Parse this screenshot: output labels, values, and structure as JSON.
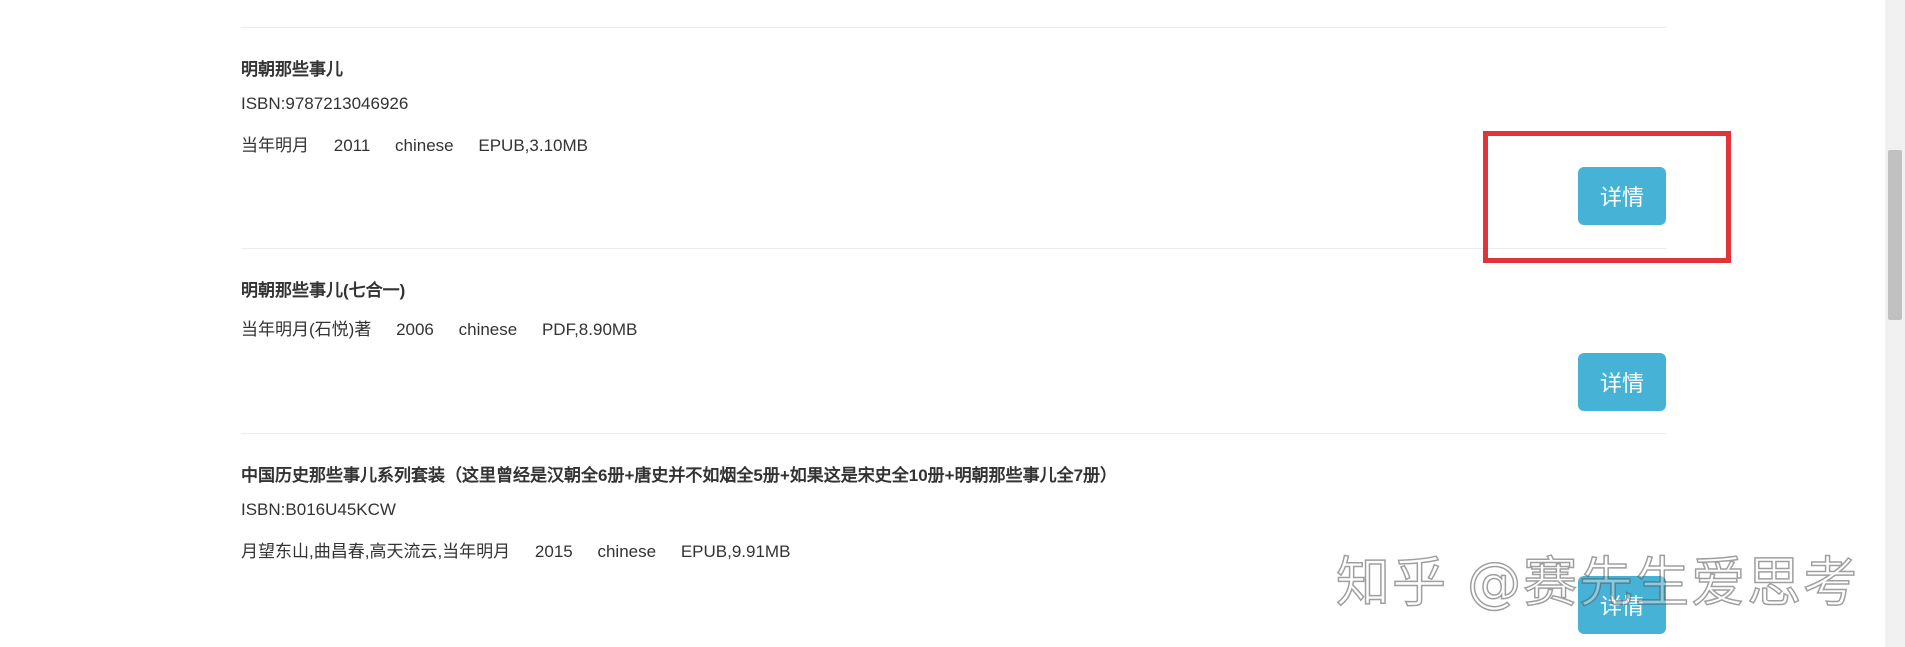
{
  "results": [
    {
      "title": "明朝那些事儿",
      "isbn": "ISBN:9787213046926",
      "author": "当年明月",
      "year": "2011",
      "language": "chinese",
      "file": "EPUB,3.10MB",
      "detail_label": "详情"
    },
    {
      "title": "明朝那些事儿(七合一)",
      "author": "当年明月(石悦)著",
      "year": "2006",
      "language": "chinese",
      "file": "PDF,8.90MB",
      "detail_label": "详情"
    },
    {
      "title": "中国历史那些事儿系列套装（这里曾经是汉朝全6册+唐史并不如烟全5册+如果这是宋史全10册+明朝那些事儿全7册）",
      "isbn": "ISBN:B016U45KCW",
      "author": "月望东山,曲昌春,高天流云,当年明月",
      "year": "2015",
      "language": "chinese",
      "file": "EPUB,9.91MB",
      "detail_label": "详情"
    }
  ],
  "watermark": "知乎 @赛先生爱思考",
  "colors": {
    "button": "#46b2d6",
    "highlight": "#e0333a",
    "divider": "#ececec"
  }
}
